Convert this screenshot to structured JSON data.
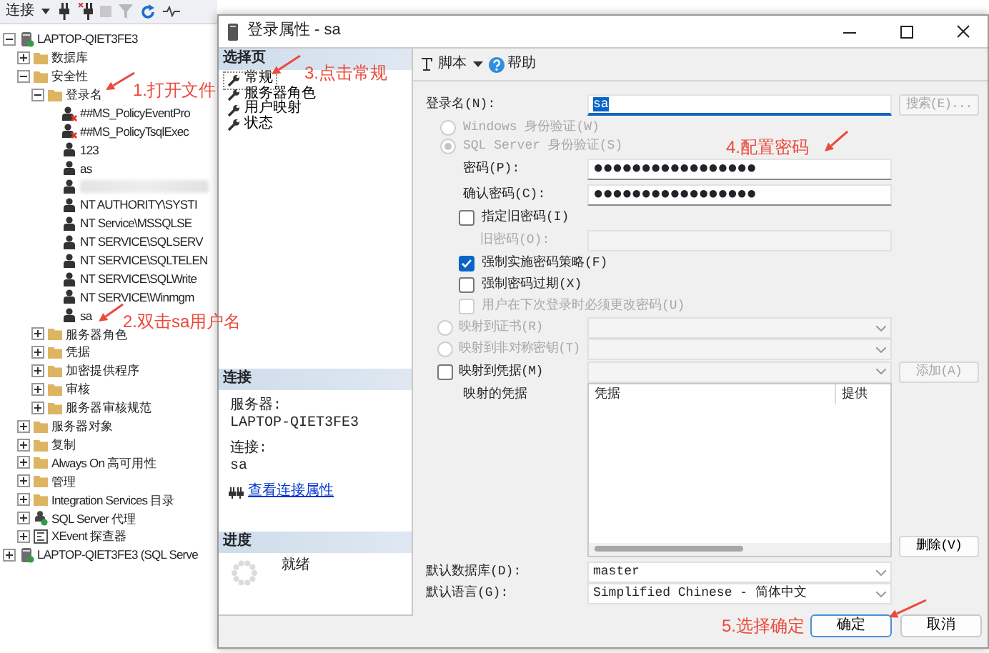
{
  "toolbar": {
    "connect_label": "连接"
  },
  "object_explorer": {
    "nodes": [
      {
        "label": "LAPTOP-QIET3FE3",
        "kind": "server",
        "expanded": true,
        "children": [
          {
            "label": "数据库",
            "kind": "folder",
            "expanded": false
          },
          {
            "label": "安全性",
            "kind": "folder",
            "expanded": true,
            "children": [
              {
                "label": "登录名",
                "kind": "folder",
                "expanded": true,
                "children": [
                  {
                    "label": "##MS_PolicyEventPro",
                    "kind": "login-disabled"
                  },
                  {
                    "label": "##MS_PolicyTsqlExec",
                    "kind": "login-disabled"
                  },
                  {
                    "label": "123",
                    "kind": "login"
                  },
                  {
                    "label": "as",
                    "kind": "login"
                  },
                  {
                    "kind": "redacted"
                  },
                  {
                    "label": "NT AUTHORITY\\SYSTI",
                    "kind": "login"
                  },
                  {
                    "label": "NT Service\\MSSQLSE",
                    "kind": "login"
                  },
                  {
                    "label": "NT SERVICE\\SQLSERV",
                    "kind": "login"
                  },
                  {
                    "label": "NT SERVICE\\SQLTELEN",
                    "kind": "login"
                  },
                  {
                    "label": "NT SERVICE\\SQLWrite",
                    "kind": "login"
                  },
                  {
                    "label": "NT SERVICE\\Winmgm",
                    "kind": "login"
                  },
                  {
                    "label": "sa",
                    "kind": "login"
                  }
                ]
              },
              {
                "label": "服务器角色",
                "kind": "folder",
                "expanded": false
              },
              {
                "label": "凭据",
                "kind": "folder",
                "expanded": false
              },
              {
                "label": "加密提供程序",
                "kind": "folder",
                "expanded": false
              },
              {
                "label": "审核",
                "kind": "folder",
                "expanded": false
              },
              {
                "label": "服务器审核规范",
                "kind": "folder",
                "expanded": false
              }
            ]
          },
          {
            "label": "服务器对象",
            "kind": "folder",
            "expanded": false
          },
          {
            "label": "复制",
            "kind": "folder",
            "expanded": false
          },
          {
            "label": "Always On 高可用性",
            "kind": "folder",
            "expanded": false
          },
          {
            "label": "管理",
            "kind": "folder",
            "expanded": false
          },
          {
            "label": "Integration Services 目录",
            "kind": "folder",
            "expanded": false
          },
          {
            "label": "SQL Server 代理",
            "kind": "agent",
            "expanded": false
          },
          {
            "label": "XEvent 探查器",
            "kind": "xevent",
            "expanded": false
          }
        ]
      },
      {
        "label": "LAPTOP-QIET3FE3 (SQL Serve",
        "kind": "server",
        "expanded": false
      }
    ]
  },
  "dialog": {
    "title": "登录属性 - sa",
    "pages_header": "选择页",
    "pages": [
      {
        "label": "常规",
        "selected": true
      },
      {
        "label": "服务器角色",
        "selected": false
      },
      {
        "label": "用户映射",
        "selected": false
      },
      {
        "label": "状态",
        "selected": false
      }
    ],
    "connection": {
      "header": "连接",
      "server_label": "服务器:",
      "server": "LAPTOP-QIET3FE3",
      "connection_label": "连接:",
      "connection": "sa",
      "link": "查看连接属性"
    },
    "progress": {
      "header": "进度",
      "status": "就绪"
    },
    "toolbar": {
      "script": "脚本",
      "help": "帮助"
    },
    "form": [
      {
        "kind": "text-field",
        "label": "登录名(N):",
        "value": "sa",
        "value_selected": true,
        "button": "搜索(E)...",
        "button_disabled": true
      },
      {
        "kind": "radio",
        "label": "Windows 身份验证(W)",
        "selected": false,
        "disabled": true
      },
      {
        "kind": "radio",
        "label": "SQL Server 身份验证(S)",
        "selected": true,
        "disabled": true
      },
      {
        "kind": "password",
        "label": "密码(P):",
        "value": "●●●●●●●●●●●●●●●●●",
        "disabled": false
      },
      {
        "kind": "password",
        "label": "确认密码(C):",
        "value": "●●●●●●●●●●●●●●●●●",
        "disabled": false
      },
      {
        "kind": "checkbox",
        "label": "指定旧密码(I)",
        "checked": false,
        "disabled": false
      },
      {
        "kind": "sub-password",
        "label": "旧密码(O):",
        "disabled": true
      },
      {
        "kind": "checkbox",
        "label": "强制实施密码策略(F)",
        "checked": true,
        "disabled": false
      },
      {
        "kind": "checkbox",
        "label": "强制密码过期(X)",
        "checked": false,
        "disabled": false
      },
      {
        "kind": "checkbox",
        "label": "用户在下次登录时必须更改密码(U)",
        "checked": false,
        "disabled": true
      },
      {
        "kind": "radio-select",
        "label": "映射到证书(R)",
        "selected": false,
        "disabled": true
      },
      {
        "kind": "radio-select",
        "label": "映射到非对称密钥(T)",
        "selected": false,
        "disabled": true
      },
      {
        "kind": "checkbox-select",
        "label": "映射到凭据(M)",
        "checked": false,
        "disabled": false,
        "button": "添加(A)",
        "button_disabled": true
      },
      {
        "kind": "table",
        "label": "映射的凭据",
        "columns": [
          "凭据",
          "提供"
        ],
        "button": "删除(V)",
        "button_disabled": false
      },
      {
        "kind": "select",
        "label": "默认数据库(D):",
        "value": "master"
      },
      {
        "kind": "select",
        "label": "默认语言(G):",
        "value": "Simplified Chinese - 简体中文"
      }
    ],
    "buttons": [
      {
        "label": "确定",
        "primary": true
      },
      {
        "label": "取消",
        "primary": false
      }
    ]
  },
  "annotations": [
    {
      "text": "1.打开文件"
    },
    {
      "text": "2.双击sa用户名"
    },
    {
      "text": "3.点击常规"
    },
    {
      "text": "4.配置密码"
    },
    {
      "text": "5.选择确定"
    }
  ]
}
